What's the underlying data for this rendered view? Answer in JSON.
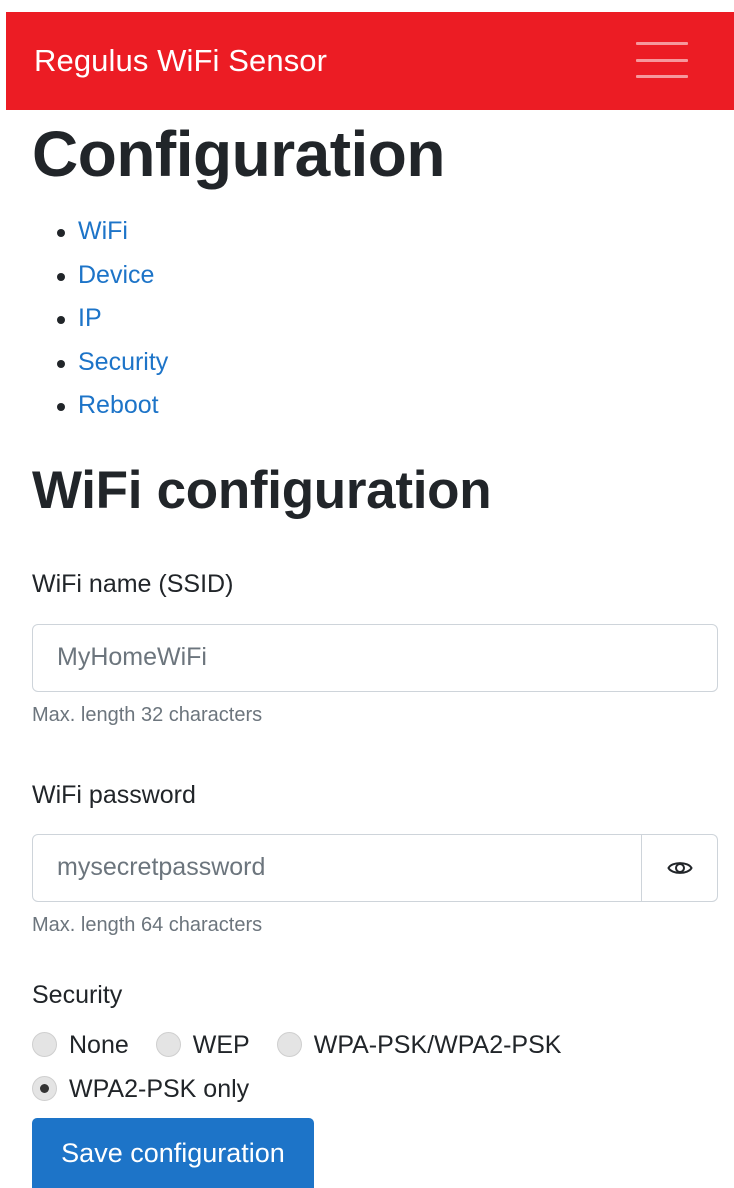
{
  "navbar": {
    "brand": "Regulus WiFi Sensor",
    "menu_icon": "hamburger-menu-icon",
    "background": "#ec1c24"
  },
  "page_title": "Configuration",
  "toc": {
    "items": [
      {
        "label": "WiFi"
      },
      {
        "label": "Device"
      },
      {
        "label": "IP"
      },
      {
        "label": "Security"
      },
      {
        "label": "Reboot"
      }
    ]
  },
  "wifi_section": {
    "heading": "WiFi configuration",
    "ssid": {
      "label": "WiFi name (SSID)",
      "placeholder": "MyHomeWiFi",
      "value": "",
      "help": "Max. length 32 characters"
    },
    "password": {
      "label": "WiFi password",
      "placeholder": "mysecretpassword",
      "value": "",
      "help": "Max. length 64 characters",
      "toggle_icon": "eye-icon"
    },
    "security": {
      "label": "Security",
      "options": [
        {
          "label": "None",
          "checked": false
        },
        {
          "label": "WEP",
          "checked": false
        },
        {
          "label": "WPA-PSK/WPA2-PSK",
          "checked": false
        },
        {
          "label": "WPA2-PSK only",
          "checked": true
        }
      ]
    },
    "save_label": "Save configuration"
  },
  "colors": {
    "link": "#1d74c8",
    "primary_button": "#1d74c8",
    "muted_text": "#6c757d"
  }
}
